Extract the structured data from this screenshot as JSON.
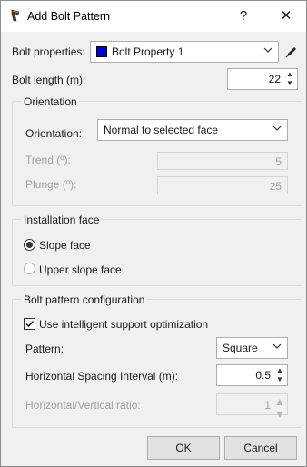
{
  "window": {
    "title": "Add Bolt Pattern",
    "help_label": "?",
    "close_label": "✕"
  },
  "bolt_properties": {
    "label": "Bolt properties:",
    "value": "Bolt Property 1",
    "swatch_color": "#0000cc"
  },
  "bolt_length": {
    "label": "Bolt length (m):",
    "value": "22"
  },
  "orientation_group": {
    "title": "Orientation",
    "orientation_label": "Orientation:",
    "orientation_value": "Normal to selected face",
    "trend_label": "Trend (º):",
    "trend_value": "5",
    "plunge_label": "Plunge (º):",
    "plunge_value": "25"
  },
  "installation_group": {
    "title": "Installation face",
    "options": [
      {
        "label": "Slope face",
        "selected": true
      },
      {
        "label": "Upper slope face",
        "selected": false
      }
    ]
  },
  "pattern_group": {
    "title": "Bolt pattern configuration",
    "optimization_label": "Use intelligent support optimization",
    "optimization_checked": true,
    "pattern_label": "Pattern:",
    "pattern_value": "Square",
    "h_spacing_label": "Horizontal Spacing Interval (m):",
    "h_spacing_value": "0.5",
    "hv_ratio_label": "Horizontal/Vertical ratio:",
    "hv_ratio_value": "1"
  },
  "buttons": {
    "ok": "OK",
    "cancel": "Cancel"
  },
  "colors": {
    "accent": "#0078d7",
    "window_bg": "#f0f0f0"
  }
}
